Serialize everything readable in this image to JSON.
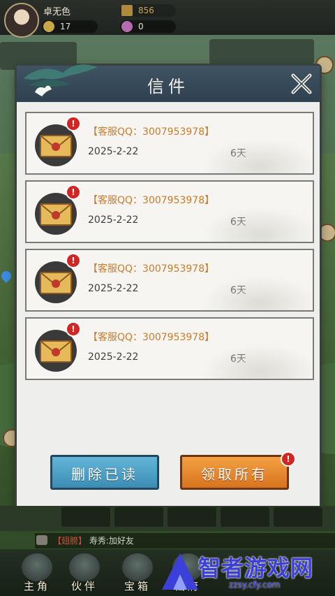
{
  "player": {
    "name": "卓无色"
  },
  "resources": {
    "coins": "17",
    "gold": "856",
    "gems": "0"
  },
  "dialog": {
    "title": "信件"
  },
  "mails": [
    {
      "sender": "【客服QQ：3007953978】",
      "date": "2025-2-22",
      "days": "6天"
    },
    {
      "sender": "【客服QQ：3007953978】",
      "date": "2025-2-22",
      "days": "6天"
    },
    {
      "sender": "【客服QQ：3007953978】",
      "date": "2025-2-22",
      "days": "6天"
    },
    {
      "sender": "【客服QQ：3007953978】",
      "date": "2025-2-22",
      "days": "6天"
    }
  ],
  "badges": {
    "unread": "!"
  },
  "buttons": {
    "delete_read": "删除已读",
    "claim_all": "领取所有"
  },
  "chat": {
    "tag": "【翅膀】",
    "message": "寿秀:加好友"
  },
  "nav": [
    {
      "label": "主角",
      "icon": "hero-icon"
    },
    {
      "label": "伙伴",
      "icon": "partner-icon"
    },
    {
      "label": "宝箱",
      "icon": "chest-icon"
    },
    {
      "label": "仙府",
      "icon": "mansion-icon"
    }
  ],
  "watermark": {
    "text": "智者游戏网",
    "url": "zzsy.cfy.com"
  },
  "colors": {
    "sender": "#c97c2a",
    "delete_button": "#3c8cb4",
    "claim_button": "#d9731f",
    "badge": "#d32521",
    "watermark": "#3c3fd8"
  }
}
